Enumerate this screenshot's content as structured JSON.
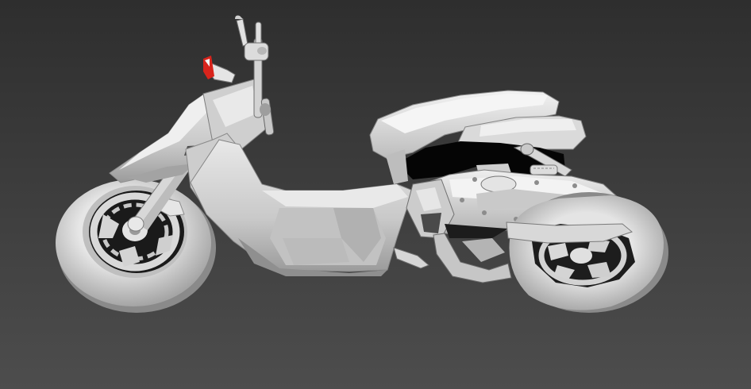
{
  "viewport": {
    "background_top": "#2e2e2e",
    "background_bottom": "#4d4d4d"
  },
  "model": {
    "subject": "scooter",
    "material_base": "#d4d4d4",
    "material_light": "#f0f0f0",
    "material_shadow": "#8a8a8a",
    "material_dark": "#4a4a4a",
    "cavity": "#050505",
    "reflector_color": "#d8241c"
  }
}
